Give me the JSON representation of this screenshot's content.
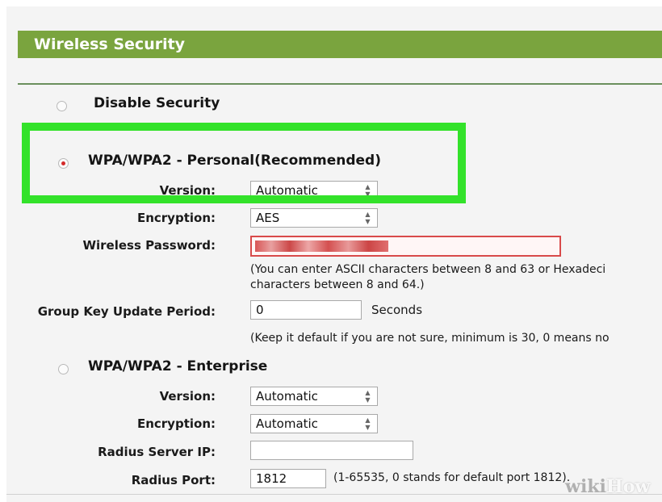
{
  "header": {
    "title": "Wireless Security"
  },
  "options": {
    "disable": {
      "label": "Disable Security",
      "selected": false
    },
    "personal": {
      "label": "WPA/WPA2 - Personal(Recommended)",
      "selected": true,
      "version_label": "Version:",
      "version_value": "Automatic",
      "encryption_label": "Encryption:",
      "encryption_value": "AES",
      "password_label": "Wireless Password:",
      "password_note_1": "(You can enter ASCII characters between 8 and 63 or Hexadeci",
      "password_note_2": "characters between 8 and 64.)",
      "group_key_label": "Group Key Update Period:",
      "group_key_value": "0",
      "group_key_unit": "Seconds",
      "group_key_note": "(Keep it default if you are not sure, minimum is 30, 0 means no"
    },
    "enterprise": {
      "label": "WPA/WPA2 - Enterprise",
      "selected": false,
      "version_label": "Version:",
      "version_value": "Automatic",
      "encryption_label": "Encryption:",
      "encryption_value": "Automatic",
      "radius_ip_label": "Radius Server IP:",
      "radius_ip_value": "",
      "radius_port_label": "Radius Port:",
      "radius_port_value": "1812",
      "radius_port_note": "(1-65535, 0 stands for default port 1812)."
    }
  },
  "colors": {
    "header_bg": "#7aa43e",
    "highlight": "#33e22a",
    "selected_radio": "#d42a2a",
    "password_border": "#d84a4a"
  },
  "watermark": {
    "wiki": "wiki",
    "how": "How"
  }
}
